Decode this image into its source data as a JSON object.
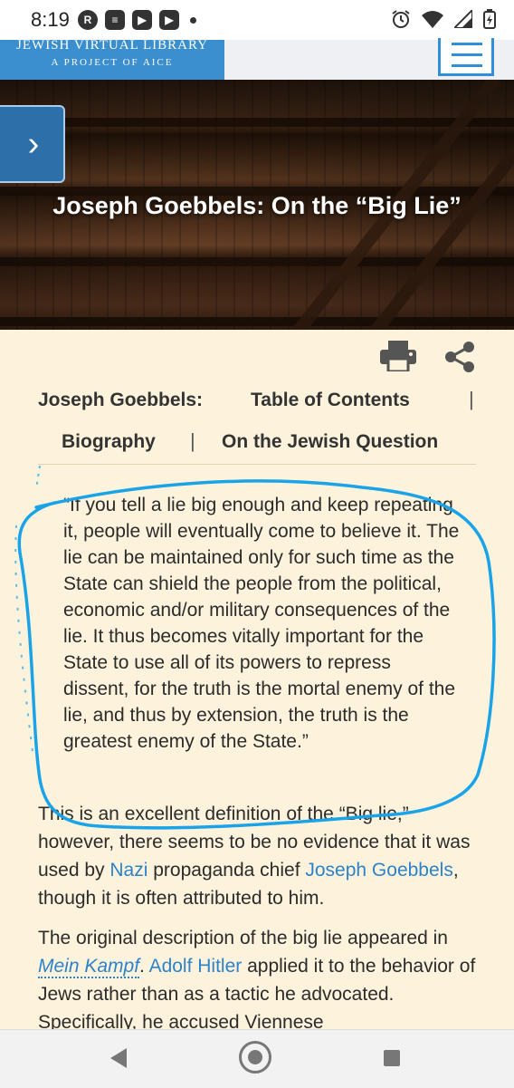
{
  "status_bar": {
    "time": "8:19",
    "left_icons": [
      "r-app-icon",
      "news-icon",
      "youtube-icon",
      "youtube-icon"
    ],
    "right_icons": [
      "alarm-icon",
      "wifi-icon",
      "signal-icon",
      "battery-icon"
    ]
  },
  "header": {
    "logo_line1": "JEWISH VIRTUAL LIBRARY",
    "logo_line2": "A PROJECT OF AICE",
    "logo_color": "#3b8fce",
    "menu_icon": "hamburger-menu-icon"
  },
  "hero": {
    "title": "Joseph Goebbels: On the “Big Lie”",
    "arrow_icon": "chevron-right-icon"
  },
  "tools": {
    "print_icon": "printer-icon",
    "share_icon": "share-icon"
  },
  "nav": {
    "item1": "Joseph Goebbels:",
    "item2": "Table of Contents",
    "item3": "Biography",
    "item4": "On the Jewish Question",
    "separator": "|"
  },
  "quote": {
    "text": "“If you tell a lie big enough and keep repeating it, people will eventually come to believe it. The lie can be maintained only for such time as the State can shield the people from the political, economic and/or military consequences of the lie. It thus becomes vitally important for the State to use all of its powers to repress dissent, for the truth is the mortal enemy of the lie, and thus by extension, the truth is the greatest enemy of the State.”"
  },
  "body": {
    "p1_a": "This is an excellent definition of the “Big lie,” however, there seems to be no evidence that it was used by ",
    "p1_link1": "Nazi",
    "p1_b": " propaganda chief ",
    "p1_link2": "Joseph Goebbels",
    "p1_c": ", though it is often attributed to him.",
    "p2_a": "The original description of the big lie appeared in ",
    "p2_link1": "Mein Kampf",
    "p2_b": ". ",
    "p2_link2": "Adolf Hitler",
    "p2_c": " applied it to the behavior of Jews rather than as a tactic he advocated. Specifically, he accused Viennese"
  },
  "colors": {
    "page_bg": "#fdf3dc",
    "link": "#2d82c9",
    "annotation": "#1aa3e8"
  },
  "nav_bar": {
    "back_icon": "back-triangle-icon",
    "home_icon": "home-circle-icon",
    "recents_icon": "recents-square-icon"
  }
}
